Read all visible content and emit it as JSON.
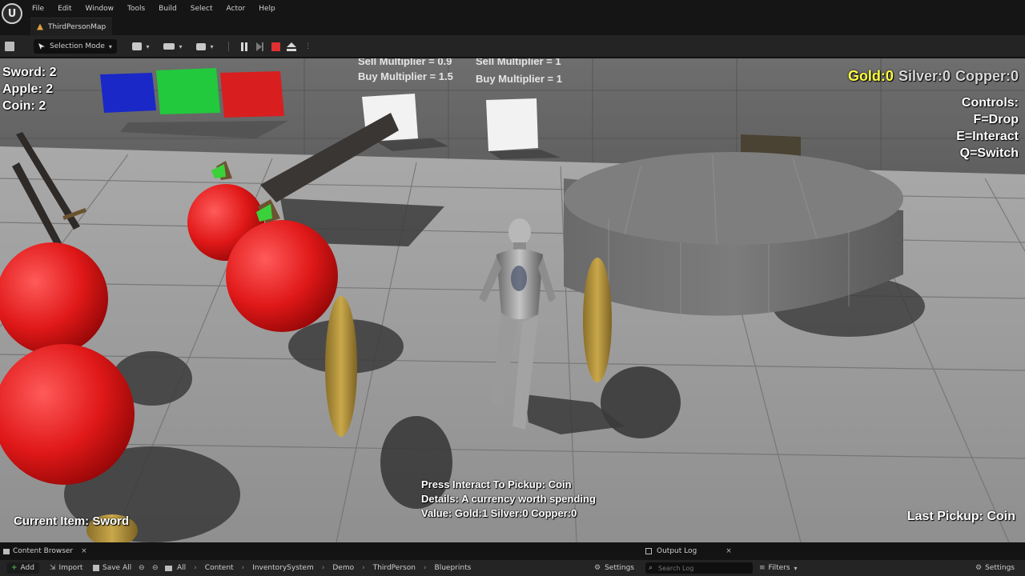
{
  "app": {
    "logo_text": "U",
    "menu": [
      "File",
      "Edit",
      "Window",
      "Tools",
      "Build",
      "Select",
      "Actor",
      "Help"
    ],
    "map_tab": "ThirdPersonMap"
  },
  "toolbar": {
    "selection_mode": "Selection Mode",
    "caret": "▾"
  },
  "viewport": {
    "inventory": [
      "Sword: 2",
      "Apple: 2",
      "Coin: 2"
    ],
    "currency": {
      "gold": "Gold:0",
      "silver": "Silver:0",
      "copper": "Copper:0",
      "gold_color": "#ffff40",
      "silver_color": "#d8d8d8",
      "copper_color": "#d8d8d8"
    },
    "controls": [
      "Controls:",
      "F=Drop",
      "E=Interact",
      "Q=Switch"
    ],
    "wall_labels": [
      "Sell Multiplier = 0.9",
      "Buy Multiplier = 1.5",
      "Sell Multiplier = 1",
      "Buy Multiplier = 1"
    ],
    "pickup_prompt": [
      "Press Interact To Pickup: Coin",
      "Details: A currency worth spending",
      "Value: Gold:1 Silver:0 Copper:0"
    ],
    "current_item": "Current Item: Sword",
    "last_pickup": "Last Pickup: Coin"
  },
  "bottom": {
    "content_browser_tab": "Content Browser",
    "output_log_tab": "Output Log",
    "close": "×",
    "add_label": "Add",
    "import_label": "Import",
    "save_all_label": "Save All",
    "breadcrumb": [
      "All",
      "Content",
      "InventorySystem",
      "Demo",
      "ThirdPerson",
      "Blueprints"
    ],
    "settings_label": "Settings",
    "search_placeholder": "Search Log",
    "filters_label": "Filters",
    "settings_right_label": "Settings"
  }
}
